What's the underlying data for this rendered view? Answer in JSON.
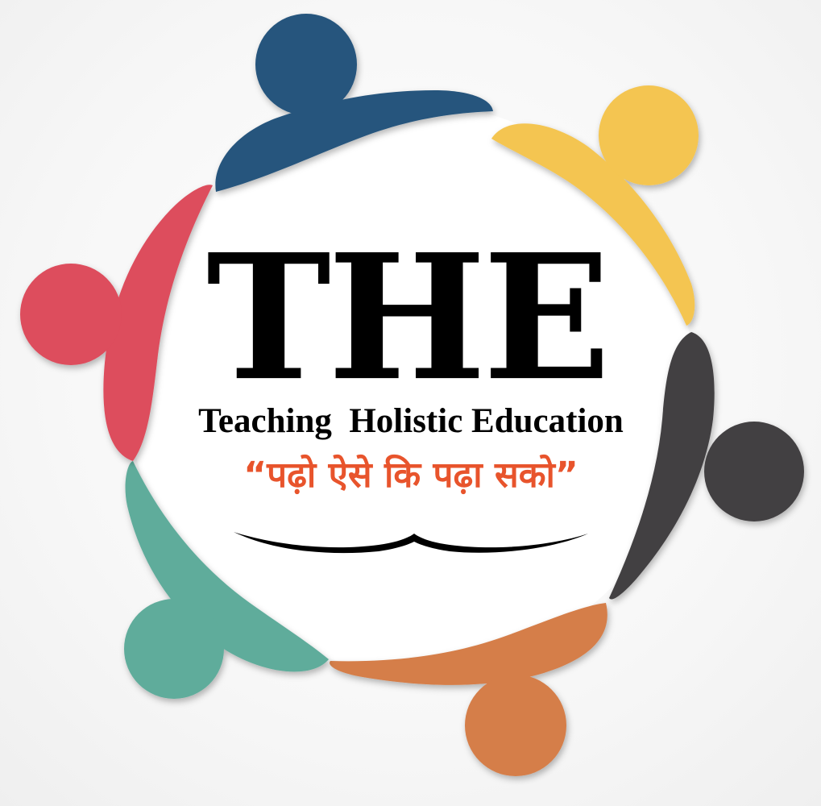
{
  "logo": {
    "acronym": "THE",
    "full_name": "Teaching  Holistic Education",
    "tagline": "“पढ़ो ऐसे कि पढ़ा सको”",
    "colors": {
      "blue": "#26557d",
      "yellow": "#f4c551",
      "gray": "#434042",
      "orange": "#d57e49",
      "teal": "#5fac9b",
      "red": "#dd4d5d",
      "tagline": "#e8542c",
      "text": "#000000"
    },
    "figures": [
      "blue-figure",
      "yellow-figure",
      "gray-figure",
      "orange-figure",
      "teal-figure",
      "red-figure"
    ],
    "ornament": "open-book-line-icon"
  }
}
